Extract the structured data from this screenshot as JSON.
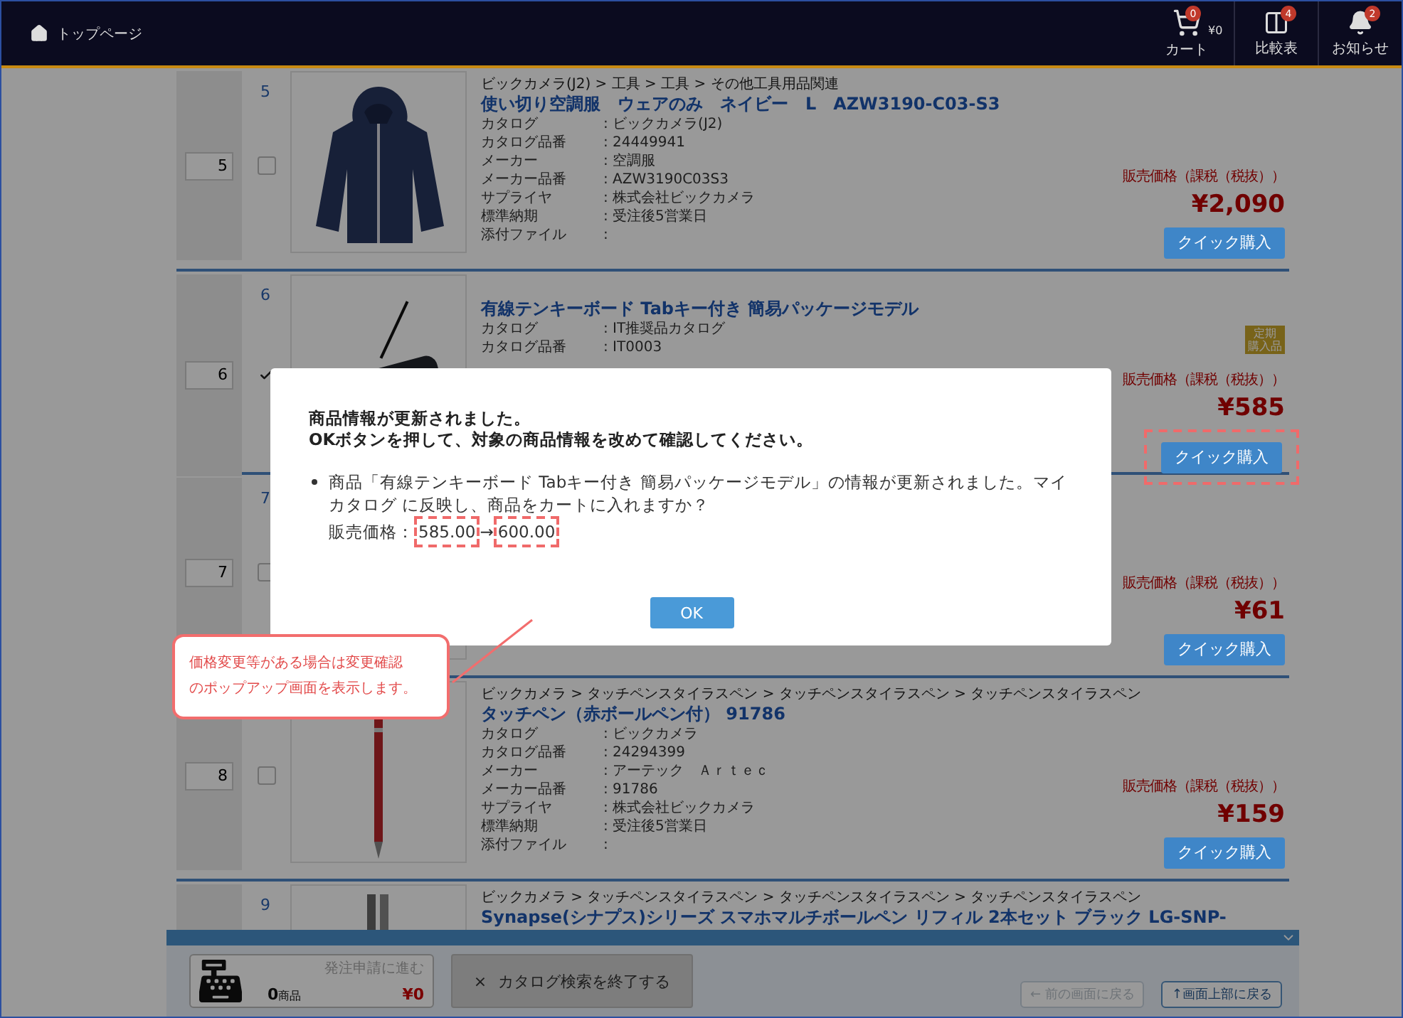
{
  "header": {
    "home_label": "トップページ",
    "cart": {
      "badge": "0",
      "amount": "¥0",
      "label": "カート"
    },
    "compare": {
      "badge": "4",
      "label": "比較表"
    },
    "notice": {
      "badge": "2",
      "label": "お知らせ"
    }
  },
  "products": [
    {
      "number": "5",
      "qty": "5",
      "checked": false,
      "kind": "picture",
      "breadcrumb": "ビックカメラ(J2) > 工具 > 工具 > その他工具用品関連",
      "title": "使い切り空調服　ウェアのみ　ネイビー　L　AZW3190-C03-S3",
      "details": [
        {
          "label": "カタログ",
          "value": ": ビックカメラ(J2)"
        },
        {
          "label": "カタログ品番",
          "value": ": 24449941"
        },
        {
          "label": "メーカー",
          "value": ": 空調服"
        },
        {
          "label": "メーカー品番",
          "value": ": AZW3190C03S3"
        },
        {
          "label": "サプライヤ",
          "value": ": 株式会社ビックカメラ"
        },
        {
          "label": "標準納期",
          "value": ": 受注後5営業日"
        },
        {
          "label": "添付ファイル",
          "value": ":"
        }
      ],
      "price_label": "販売価格（課税（税抜））",
      "price": "¥2,090",
      "buy_button": "クイック購入",
      "highlighted": false
    },
    {
      "number": "6",
      "qty": "6",
      "checked": true,
      "kind": "picture",
      "title": "有線テンキーボード Tabキー付き 簡易パッケージモデル",
      "details": [
        {
          "label": "カタログ",
          "value": ": IT推奨品カタログ"
        },
        {
          "label": "カタログ品番",
          "value": ": IT0003"
        }
      ],
      "badge": [
        "定期",
        "購入品"
      ],
      "price_label": "販売価格（課税（税抜））",
      "price": "¥585",
      "buy_button": "クイック購入",
      "highlighted": true
    },
    {
      "number": "7",
      "qty": "7",
      "checked": false,
      "price_label": "販売価格（課税（税抜））",
      "price": "¥61",
      "buy_button": "クイック購入",
      "highlighted": false
    },
    {
      "qty": "8",
      "checked": false,
      "kind": "picture",
      "breadcrumb": "ビックカメラ > タッチペンスタイラスペン > タッチペンスタイラスペン > タッチペンスタイラスペン",
      "title": "タッチペン（赤ボールペン付） 91786",
      "details": [
        {
          "label": "カタログ",
          "value": ": ビックカメラ"
        },
        {
          "label": "カタログ品番",
          "value": ": 24294399"
        },
        {
          "label": "メーカー",
          "value": ": アーテック　Ａｒｔｅｃ"
        },
        {
          "label": "メーカー品番",
          "value": ": 91786"
        },
        {
          "label": "サプライヤ",
          "value": ": 株式会社ビックカメラ"
        },
        {
          "label": "標準納期",
          "value": ": 受注後5営業日"
        },
        {
          "label": "添付ファイル",
          "value": ":"
        }
      ],
      "price_label": "販売価格（課税（税抜））",
      "price": "¥159",
      "buy_button": "クイック購入",
      "highlighted": false
    },
    {
      "number": "9",
      "kind": "picture",
      "breadcrumb": "ビックカメラ > タッチペンスタイラスペン > タッチペンスタイラスペン > タッチペンスタイラスペン",
      "title": "Synapse(シナプス)シリーズ スマホマルチボールペン リフィル 2本セット ブラック LG-SNP-"
    }
  ],
  "modal": {
    "lines": [
      "商品情報が更新されました。",
      "OKボタンを押して、対象の商品情報を改めて確認してください。"
    ],
    "message": "商品「有線テンキーボード Tabキー付き 簡易パッケージモデル」の情報が更新されました。マイカタログ に反映し、商品をカートに入れますか？",
    "price_label": "販売価格：",
    "old_price": {
      "text": "585.00",
      "highlighted": true
    },
    "arrow": "→",
    "new_price": {
      "text": "600.00",
      "highlighted": true
    },
    "ok_button": "OK"
  },
  "callout": [
    "価格変更等がある場合は変更確認",
    "のポップアップ画面を表示します。"
  ],
  "bottom_bar": {
    "proceed": "発注申請に進む",
    "count": "0",
    "unit": "商品",
    "total": "¥0",
    "close_button": {
      "icon": "×",
      "label": "カタログ検索を終了する"
    },
    "back_button": {
      "label": "← 前の画面に戻る",
      "disabled": true
    },
    "top_button": {
      "label": "↑画面上部に戻る",
      "disabled": false
    }
  }
}
